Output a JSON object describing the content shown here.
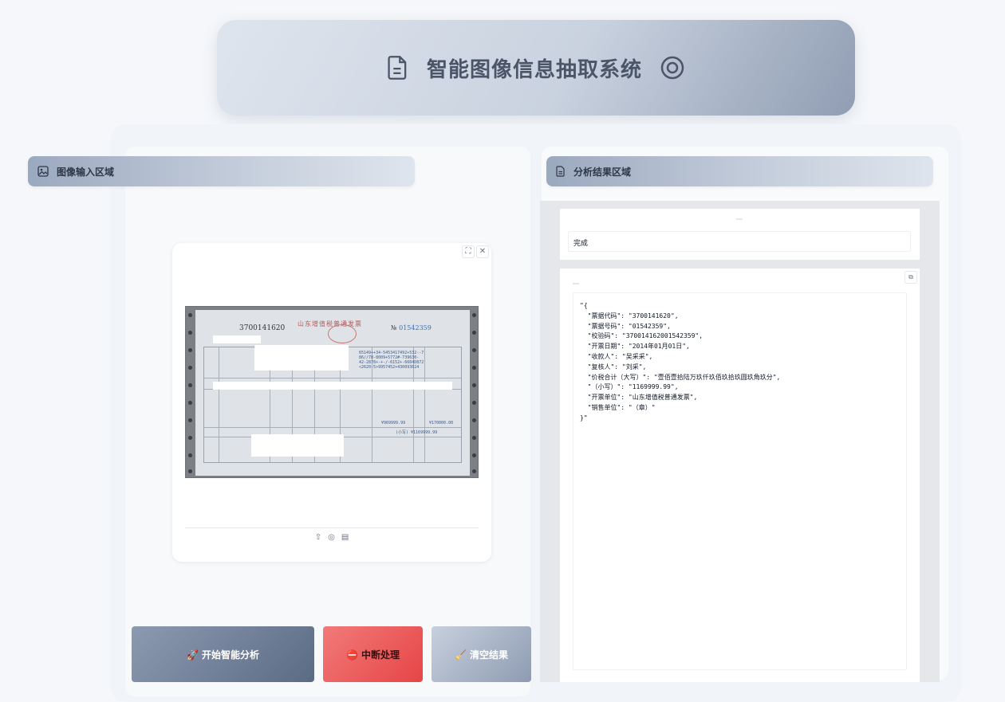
{
  "header": {
    "title": "智能图像信息抽取系统"
  },
  "input_section": {
    "title": "图像输入区域"
  },
  "result_section": {
    "title": "分析结果区域"
  },
  "image_tools": {
    "fullscreen": "⛶",
    "close": "✕"
  },
  "invoice": {
    "code": "3700141620",
    "title": "山东增值税普通发票",
    "number_prefix": "№",
    "number": "01542359",
    "cipher": "65149++34-5453417492+532--7\n86//78-8009+5772#-739630-\n42-2878+-+-/-6152+-6604D872\n<2620-5>9957452+430093624",
    "amount_a": "¥969999.99",
    "amount_b": "¥170000.00",
    "total_small": "(小写) ¥1169999.99"
  },
  "buttons": {
    "start": "🚀 开始智能分析",
    "stop": "⛔ 中断处理",
    "clear": "🧹 清空结果"
  },
  "status": {
    "value": "完成"
  },
  "result_json": "\"{\n  \"票据代码\": \"3700141620\",\n  \"票据号码\": \"01542359\",\n  \"校验码\": \"370014162001542359\",\n  \"开票日期\": \"2014年01月01日\",\n  \"收款人\": \"吴采采\",\n  \"复核人\": \"刘采\",\n  \"价税合计（大写）\": \"壹佰壹拾陆万玖仟玖佰玖拾玖圆玖角玖分\",\n  \"（小写）\": \"1169999.99\",\n  \"开票单位\": \"山东增值税普通发票\",\n  \"销售单位\": \"（章）\"\n}\""
}
